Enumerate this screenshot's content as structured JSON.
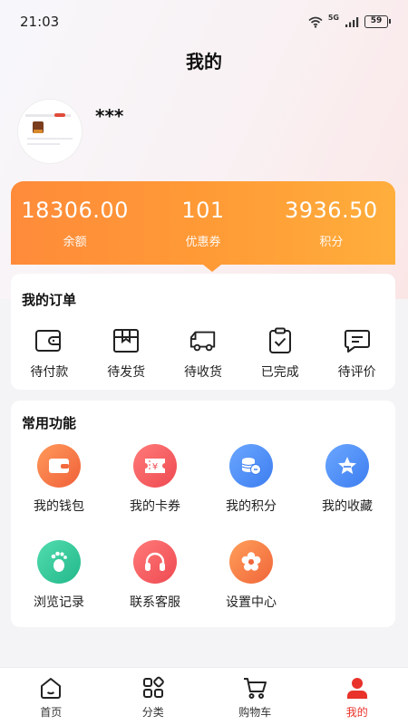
{
  "status": {
    "time": "21:03",
    "network": "5G",
    "battery": "59"
  },
  "header": {
    "title": "我的"
  },
  "user": {
    "name": "***"
  },
  "assets": [
    {
      "value": "18306.00",
      "label": "余额"
    },
    {
      "value": "101",
      "label": "优惠券"
    },
    {
      "value": "3936.50",
      "label": "积分"
    }
  ],
  "orders": {
    "title": "我的订单",
    "items": [
      {
        "label": "待付款",
        "icon": "wallet-icon"
      },
      {
        "label": "待发货",
        "icon": "package-icon"
      },
      {
        "label": "待收货",
        "icon": "truck-icon"
      },
      {
        "label": "已完成",
        "icon": "clipboard-check-icon"
      },
      {
        "label": "待评价",
        "icon": "comment-icon"
      }
    ]
  },
  "functions": {
    "title": "常用功能",
    "items": [
      {
        "label": "我的钱包",
        "icon": "wallet-icon",
        "color": "#f46a3c"
      },
      {
        "label": "我的卡券",
        "icon": "coupon-icon",
        "color": "#f0565a"
      },
      {
        "label": "我的积分",
        "icon": "coins-icon",
        "color": "#4a8cf5"
      },
      {
        "label": "我的收藏",
        "icon": "star-icon",
        "color": "#4a8cf5"
      },
      {
        "label": "浏览记录",
        "icon": "footprint-icon",
        "color": "#2ec79a"
      },
      {
        "label": "联系客服",
        "icon": "headset-icon",
        "color": "#f0565a"
      },
      {
        "label": "设置中心",
        "icon": "flower-gear-icon",
        "color": "#f47a3c"
      }
    ]
  },
  "tabs": [
    {
      "label": "首页",
      "icon": "home-icon",
      "active": false
    },
    {
      "label": "分类",
      "icon": "category-icon",
      "active": false
    },
    {
      "label": "购物车",
      "icon": "cart-icon",
      "active": false
    },
    {
      "label": "我的",
      "icon": "user-icon",
      "active": true
    }
  ],
  "colors": {
    "accent": "#e8322a",
    "asset_gradient_start": "#ff8b3a",
    "asset_gradient_end": "#ffae3c"
  }
}
